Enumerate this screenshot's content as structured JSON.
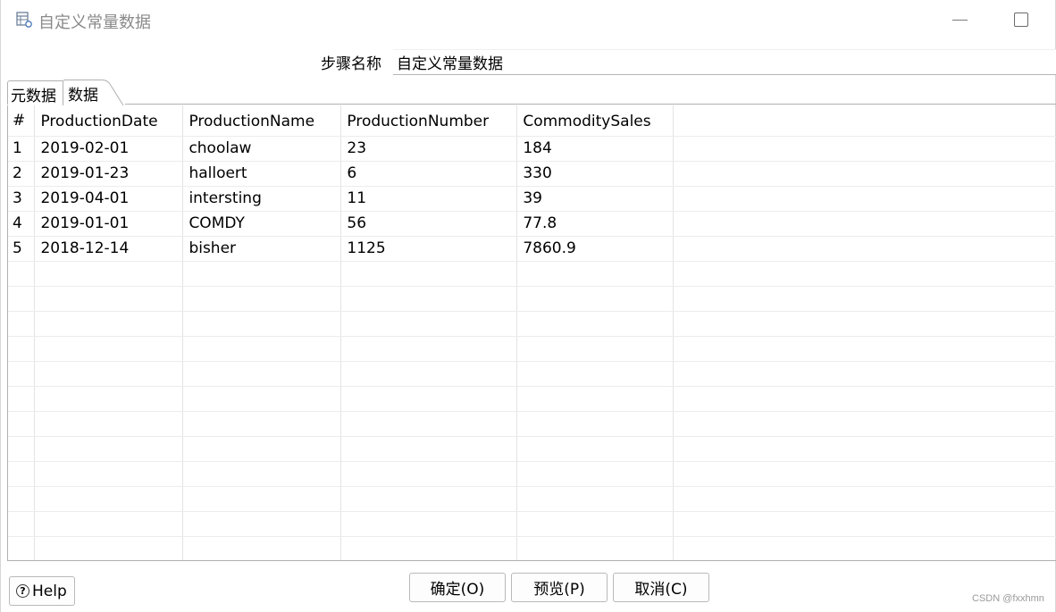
{
  "window": {
    "title": "自定义常量数据"
  },
  "step": {
    "label": "步骤名称",
    "value": "自定义常量数据"
  },
  "tabs": [
    {
      "label": "元数据",
      "active": false
    },
    {
      "label": "数据",
      "active": true
    }
  ],
  "table": {
    "columns": [
      "#",
      "ProductionDate",
      "ProductionName",
      "ProductionNumber",
      "CommoditySales"
    ],
    "rows": [
      [
        "1",
        "2019-02-01",
        "choolaw",
        "23",
        "184"
      ],
      [
        "2",
        "2019-01-23",
        "halloert",
        "6",
        "330"
      ],
      [
        "3",
        "2019-04-01",
        "intersting",
        "11",
        "39"
      ],
      [
        "4",
        "2019-01-01",
        "COMDY",
        "56",
        "77.8"
      ],
      [
        "5",
        "2018-12-14",
        "bisher",
        "1125",
        "7860.9"
      ]
    ],
    "empty_row_count": 12
  },
  "buttons": {
    "help": "Help",
    "ok": "确定(O)",
    "preview": "预览(P)",
    "cancel": "取消(C)"
  },
  "icons": {
    "title": "spreadsheet-icon",
    "help": "help-circle-icon",
    "minimize": "minimize-icon",
    "maximize": "maximize-icon"
  },
  "watermark": "CSDN @fxxhmn"
}
